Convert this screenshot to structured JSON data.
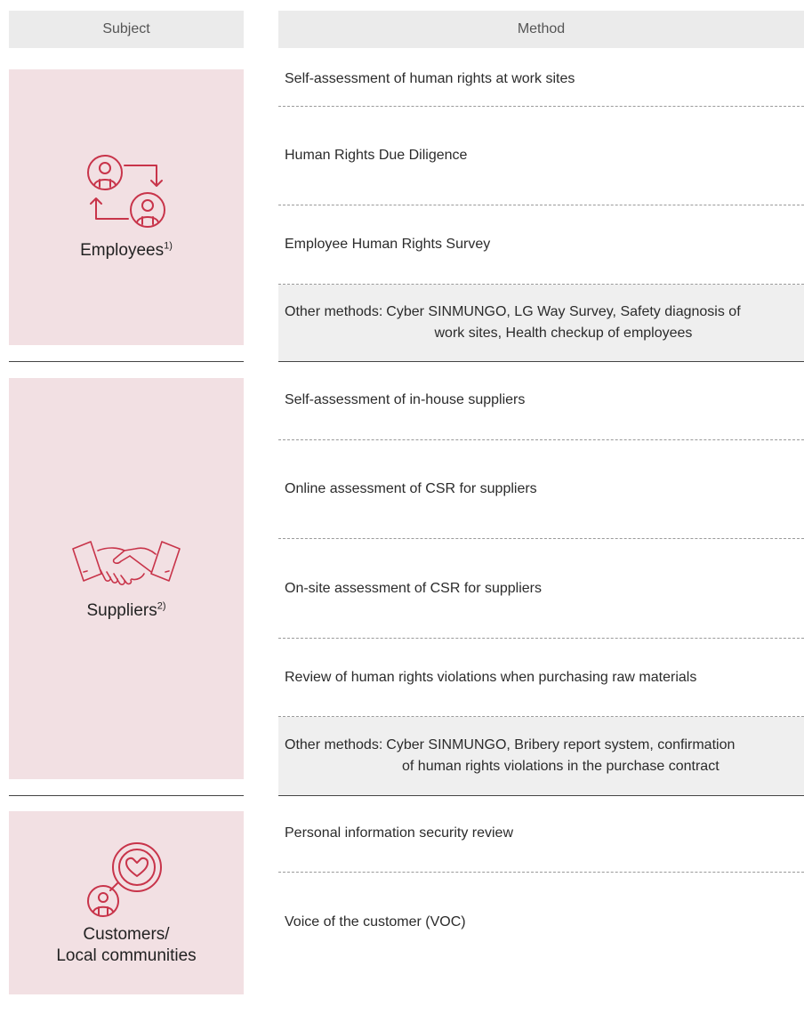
{
  "headers": {
    "subject": "Subject",
    "method": "Method"
  },
  "employees": {
    "label": "Employees",
    "footnote": "1)",
    "icon": "employee-exchange-icon",
    "methods": [
      "Self-assessment of human rights at work sites",
      "Human Rights Due Diligence",
      "Employee Human Rights Survey"
    ],
    "other_key": "Other methods:",
    "other_line1": "Cyber SINMUNGO, LG Way Survey, Safety diagnosis of",
    "other_line2": "work sites, Health checkup of employees"
  },
  "suppliers": {
    "label": "Suppliers",
    "footnote": "2)",
    "icon": "handshake-icon",
    "methods": [
      "Self-assessment of in-house suppliers",
      "Online assessment of CSR for suppliers",
      "On-site assessment of CSR for suppliers",
      "Review of human rights violations when purchasing raw materials"
    ],
    "other_key": "Other methods:",
    "other_line1": "Cyber SINMUNGO, Bribery report system, confirmation",
    "other_line2": "of human rights violations in the purchase contract"
  },
  "customers": {
    "label_line1": "Customers/",
    "label_line2": "Local communities",
    "icon": "heart-speech-person-icon",
    "methods": [
      "Personal information security review",
      "Voice of the customer (VOC)"
    ]
  },
  "colors": {
    "accent": "#c8344a",
    "subject_bg": "#f2e0e3",
    "header_bg": "#ebebeb",
    "shade_bg": "#efefef"
  }
}
